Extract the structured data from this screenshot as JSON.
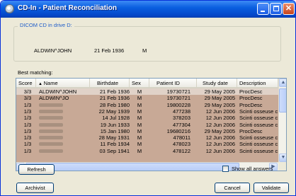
{
  "window": {
    "title": "CD-In - Patient Reconciliation"
  },
  "dicom_group": {
    "caption": "DICOM CD in drive D:",
    "patient_name": "ALDWIN^JOHN",
    "birthdate": "21 Feb 1936",
    "sex": "M"
  },
  "best_matching": {
    "label": "Best matching:",
    "sort_column": "Name",
    "columns": [
      "Score",
      "Name",
      "Birthdate",
      "Sex",
      "Patient ID",
      "Study date",
      "Description"
    ],
    "rows": [
      {
        "score": "3/3",
        "name": "ALDWIN^JOHN",
        "birthdate": "21 Feb 1936",
        "sex": "M",
        "patient_id": "19730721",
        "study_date": "29 May 2005",
        "description": "ProcDesc",
        "selected": true
      },
      {
        "score": "3/3",
        "name": "ALDWIN^JO",
        "birthdate": "21 Feb 1936",
        "sex": "M",
        "patient_id": "19730721",
        "study_date": "29 May 2005",
        "description": "ProcDesc",
        "selected": false
      },
      {
        "score": "1/3",
        "name": "",
        "birthdate": "28 Feb 1980",
        "sex": "M",
        "patient_id": "19800228",
        "study_date": "29 May 2005",
        "description": "ProcDesc",
        "selected": false
      },
      {
        "score": "1/3",
        "name": "",
        "birthdate": "22 May 1939",
        "sex": "M",
        "patient_id": "477238",
        "study_date": "12 Jun 2006",
        "description": "Scinti osseuse c",
        "selected": false
      },
      {
        "score": "1/3",
        "name": "",
        "birthdate": "14 Jul 1928",
        "sex": "M",
        "patient_id": "378203",
        "study_date": "12 Jun 2006",
        "description": "Scinti osseuse c",
        "selected": false
      },
      {
        "score": "1/3",
        "name": "",
        "birthdate": "19 Jun 1933",
        "sex": "M",
        "patient_id": "477304",
        "study_date": "12 Jun 2006",
        "description": "Scinti osseuse c",
        "selected": false
      },
      {
        "score": "1/3",
        "name": "",
        "birthdate": "15 Jan 1980",
        "sex": "M",
        "patient_id": "19680216",
        "study_date": "29 May 2005",
        "description": "ProcDesc",
        "selected": false
      },
      {
        "score": "1/3",
        "name": "",
        "birthdate": "28 May 1931",
        "sex": "M",
        "patient_id": "478011",
        "study_date": "12 Jun 2006",
        "description": "Scinti osseuse c",
        "selected": false
      },
      {
        "score": "1/3",
        "name": "",
        "birthdate": "11 Feb 1934",
        "sex": "M",
        "patient_id": "478023",
        "study_date": "12 Jun 2006",
        "description": "Scinti osseuse c",
        "selected": false
      },
      {
        "score": "1/3",
        "name": "",
        "birthdate": "03 Sep 1941",
        "sex": "M",
        "patient_id": "478122",
        "study_date": "12 Jun 2006",
        "description": "Scinti osseuse c",
        "selected": false
      }
    ]
  },
  "buttons": {
    "refresh": "Refresh",
    "archivist": "Archivist",
    "cancel": "Cancel",
    "validate": "Validate"
  },
  "show_all_answers": {
    "label": "Show all answers",
    "checked": false
  },
  "colors": {
    "titlebar": "#0a5fe0",
    "row_background": "#c8a996",
    "row_selected": "#e0d2c8",
    "group_caption": "#1c5bc9",
    "window_background": "#ece9d8"
  }
}
